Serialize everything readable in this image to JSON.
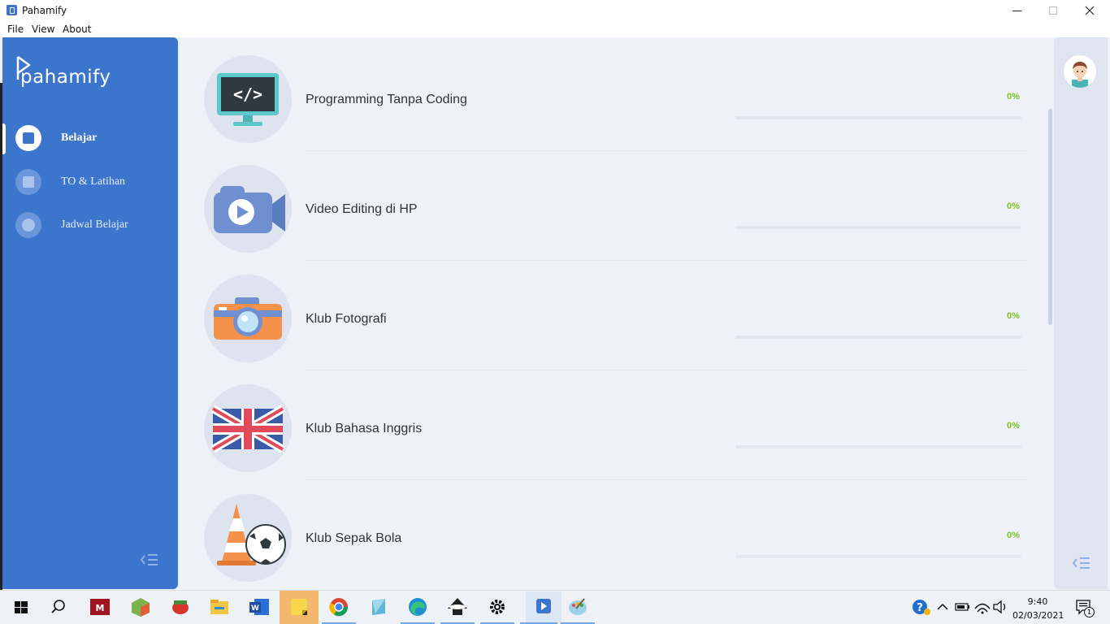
{
  "window": {
    "title": "Pahamify"
  },
  "menu": {
    "items": [
      "File",
      "View",
      "About"
    ]
  },
  "brand": {
    "name": "pahamify",
    "accent": "#3b75cc",
    "progress_color": "#7ac51b"
  },
  "sidebar": {
    "items": [
      {
        "label": "Belajar",
        "icon": "book-icon",
        "active": true
      },
      {
        "label": "TO & Latihan",
        "icon": "edit-icon",
        "active": false
      },
      {
        "label": "Jadwal Belajar",
        "icon": "clock-icon",
        "active": false
      }
    ]
  },
  "courses": [
    {
      "title": "Programming Tanpa Coding",
      "percent": "0%",
      "progress": 0,
      "icon": "code-monitor-icon"
    },
    {
      "title": "Video Editing di HP",
      "percent": "0%",
      "progress": 0,
      "icon": "video-camera-icon"
    },
    {
      "title": "Klub Fotografi",
      "percent": "0%",
      "progress": 0,
      "icon": "camera-icon"
    },
    {
      "title": "Klub Bahasa Inggris",
      "percent": "0%",
      "progress": 0,
      "icon": "uk-flag-icon"
    },
    {
      "title": "Klub Sepak Bola",
      "percent": "0%",
      "progress": 0,
      "icon": "soccer-ball-cone-icon"
    }
  ],
  "taskbar": {
    "time": "9:40",
    "date": "02/03/2021",
    "notification_count": "1"
  }
}
